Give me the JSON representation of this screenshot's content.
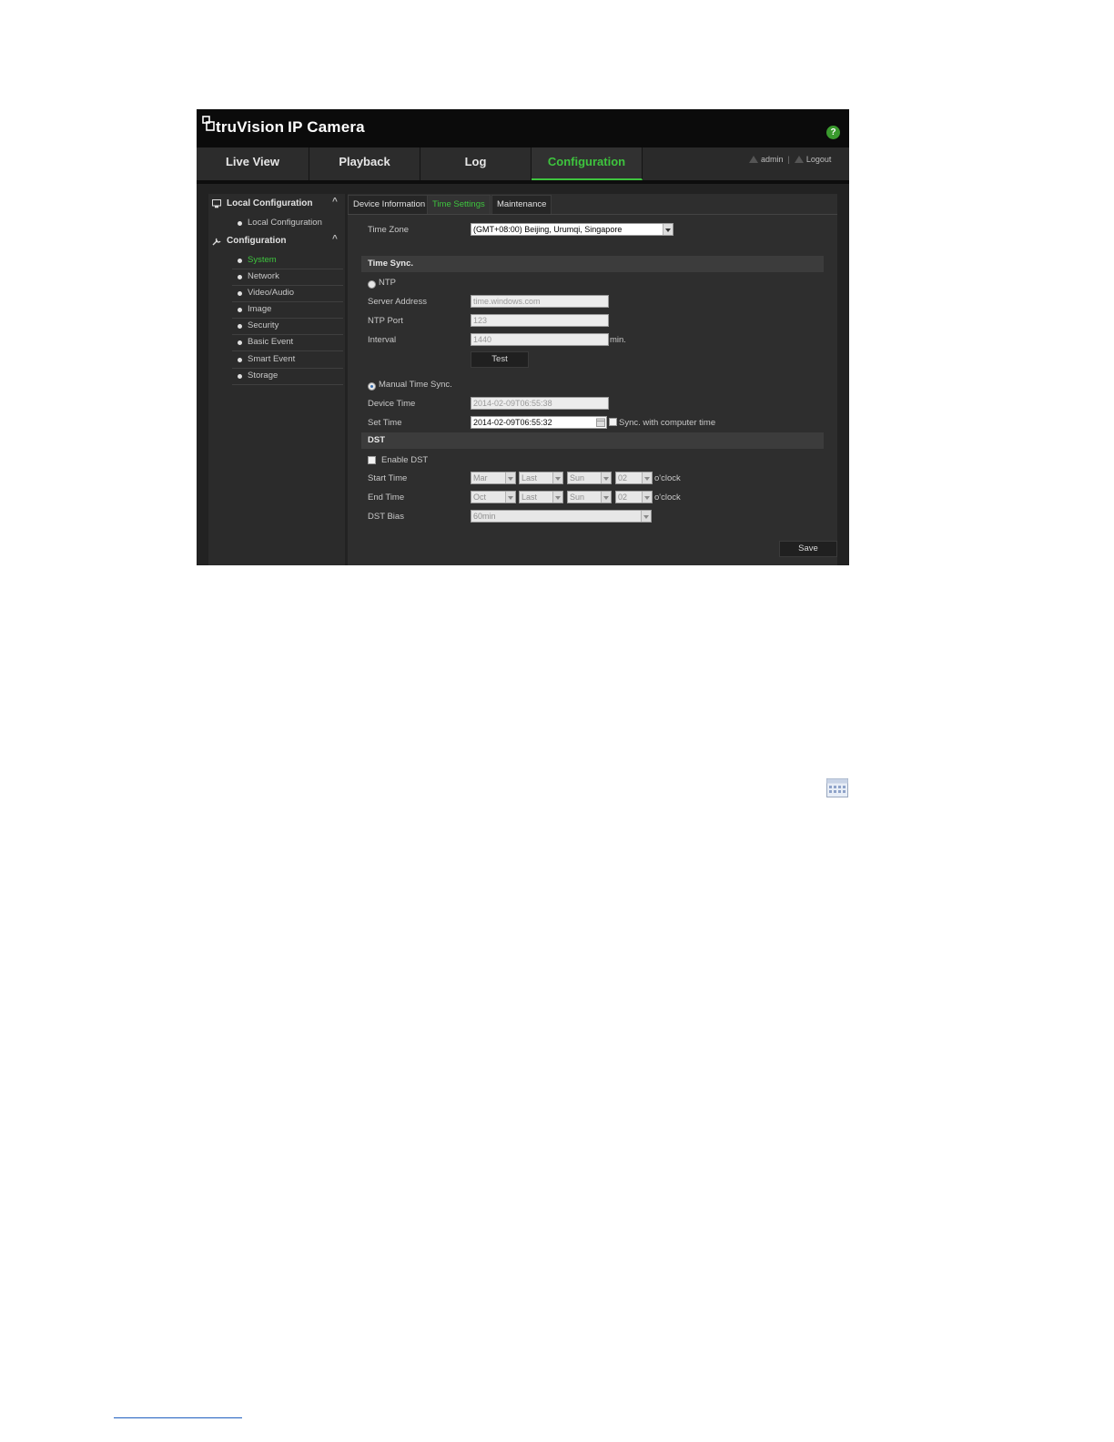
{
  "app": {
    "brand": "truVision",
    "product": "IP Camera",
    "help": "?"
  },
  "nav": {
    "tabs": [
      "Live View",
      "Playback",
      "Log",
      "Configuration"
    ],
    "active": "Configuration",
    "user": "admin",
    "logout": "Logout",
    "separator": "|"
  },
  "sidebar": {
    "local_header": "Local Configuration",
    "local_items": [
      "Local Configuration"
    ],
    "config_header": "Configuration",
    "config_items": [
      "System",
      "Network",
      "Video/Audio",
      "Image",
      "Security",
      "Basic Event",
      "Smart Event",
      "Storage"
    ],
    "active_item": "System",
    "chevron": "^"
  },
  "tabs": {
    "items": [
      "Device Information",
      "Time Settings",
      "Maintenance"
    ],
    "active": "Time Settings"
  },
  "form": {
    "time_zone_label": "Time Zone",
    "time_zone_value": "(GMT+08:00) Beijing, Urumqi, Singapore",
    "time_sync_section": "Time Sync.",
    "ntp_label": "NTP",
    "server_address_label": "Server Address",
    "server_address_value": "time.windows.com",
    "ntp_port_label": "NTP Port",
    "ntp_port_value": "123",
    "interval_label": "Interval",
    "interval_value": "1440",
    "interval_unit": "min.",
    "test_button": "Test",
    "manual_label": "Manual Time Sync.",
    "device_time_label": "Device Time",
    "device_time_value": "2014-02-09T06:55:38",
    "set_time_label": "Set Time",
    "set_time_value": "2014-02-09T06:55:32",
    "sync_computer_label": "Sync. with computer time",
    "dst_section": "DST",
    "enable_dst_label": "Enable DST",
    "start_time_label": "Start Time",
    "start_month": "Mar",
    "start_week": "Last",
    "start_day": "Sun",
    "start_hour": "02",
    "end_time_label": "End Time",
    "end_month": "Oct",
    "end_week": "Last",
    "end_day": "Sun",
    "end_hour": "02",
    "oclock": "o'clock",
    "dst_bias_label": "DST Bias",
    "dst_bias_value": "60min",
    "save_button": "Save"
  },
  "colors": {
    "accent_green": "#3ec43e",
    "background": "#1c1c1c"
  }
}
